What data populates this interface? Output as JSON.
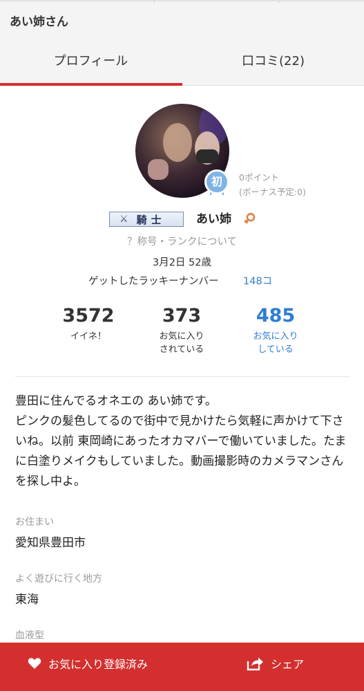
{
  "header": {
    "title": "あい姉さん"
  },
  "tabs": [
    {
      "label": "プロフィール",
      "active": true
    },
    {
      "label": "口コミ(22)",
      "active": false
    }
  ],
  "profile": {
    "rank_badge": "初",
    "points": "0ポイント",
    "bonus": "(ボーナス予定:0)",
    "title_badge": "騎士",
    "username": "あい姉",
    "title_help": "？称号・ランクについて",
    "birthday_age": "3月2日 52歳",
    "lucky_label": "ゲットしたラッキーナンバー",
    "lucky_count": "148コ"
  },
  "stats": {
    "likes": {
      "value": "3572",
      "label": "イイネ！"
    },
    "favorited_by": {
      "value": "373",
      "label_line1": "お気に入り",
      "label_line2": "されている"
    },
    "favorites": {
      "value": "485",
      "label_line1": "お気に入り",
      "label_line2": "している"
    }
  },
  "bio": [
    "豊田に住んでるオネエの あい姉です。",
    "ピンクの髪色してるので街中で見かけたら気軽に声かけて下さいね。以前 東岡崎にあったオカマバーで働いていました。たまに白塗りメイクもしていました。動画撮影時のカメラマンさんを探し中よ。"
  ],
  "fields": [
    {
      "label": "お住まい",
      "value": "愛知県豊田市"
    },
    {
      "label": "よく遊びに行く地方",
      "value": "東海"
    },
    {
      "label": "血液型",
      "value": ""
    }
  ],
  "bottom_bar": {
    "favorite_label": "お気に入り登録済み",
    "share_label": "シェア"
  },
  "colors": {
    "accent_red": "#d32f2f",
    "link_blue": "#2d7dd2",
    "rank_blue": "#7fb3e6"
  },
  "icons": [
    "heart-icon",
    "share-icon",
    "sword-icon",
    "female-icon"
  ]
}
